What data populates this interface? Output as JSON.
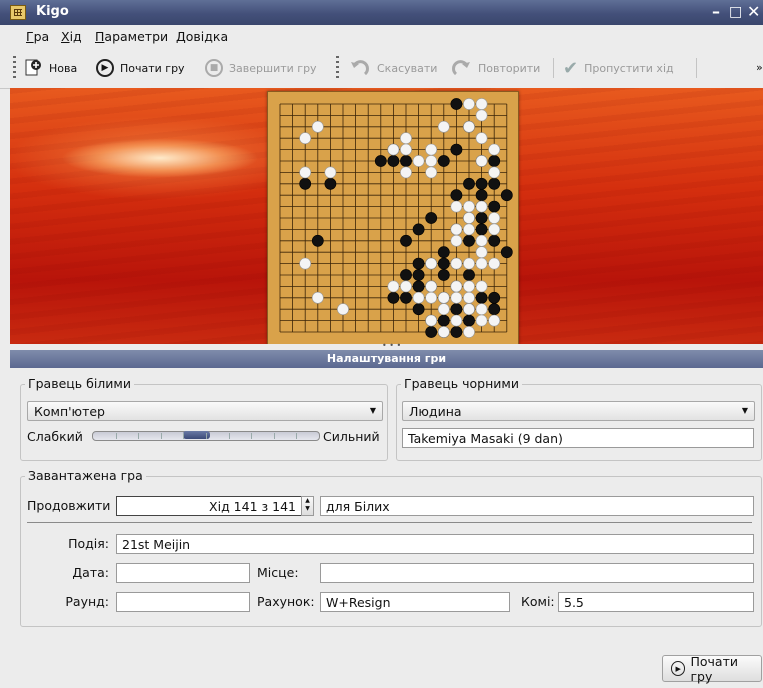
{
  "window": {
    "title": "Kigo"
  },
  "menu": [
    {
      "label": "Гра",
      "accel": "Г",
      "rest": "ра"
    },
    {
      "label": "Хід",
      "accel": "Х",
      "rest": "ід"
    },
    {
      "label": "Параметри",
      "accel": "П",
      "rest": "араметри"
    },
    {
      "label": "Довідка",
      "accel": "Д",
      "rest": "овідка"
    }
  ],
  "toolbar": {
    "new": "Нова",
    "start": "Почати гру",
    "finish": "Завершити гру",
    "undo": "Скасувати",
    "redo": "Повторити",
    "pass": "Пропустити хід"
  },
  "board": {
    "size": 19,
    "stones": {
      "black": [
        [
          14,
          0
        ],
        [
          15,
          2
        ],
        [
          9,
          4
        ],
        [
          14,
          4
        ],
        [
          8,
          5
        ],
        [
          9,
          5
        ],
        [
          10,
          5
        ],
        [
          13,
          5
        ],
        [
          16,
          5
        ],
        [
          17,
          5
        ],
        [
          2,
          7
        ],
        [
          4,
          7
        ],
        [
          15,
          7
        ],
        [
          16,
          7
        ],
        [
          17,
          7
        ],
        [
          14,
          8
        ],
        [
          16,
          8
        ],
        [
          18,
          8
        ],
        [
          16,
          9
        ],
        [
          17,
          9
        ],
        [
          12,
          10
        ],
        [
          15,
          10
        ],
        [
          16,
          10
        ],
        [
          11,
          11
        ],
        [
          14,
          11
        ],
        [
          16,
          11
        ],
        [
          3,
          12
        ],
        [
          10,
          12
        ],
        [
          15,
          12
        ],
        [
          17,
          12
        ],
        [
          13,
          13
        ],
        [
          18,
          13
        ],
        [
          11,
          14
        ],
        [
          12,
          14
        ],
        [
          13,
          14
        ],
        [
          14,
          14
        ],
        [
          10,
          15
        ],
        [
          11,
          15
        ],
        [
          13,
          15
        ],
        [
          15,
          15
        ],
        [
          11,
          16
        ],
        [
          12,
          16
        ],
        [
          14,
          16
        ],
        [
          9,
          17
        ],
        [
          10,
          17
        ],
        [
          13,
          17
        ],
        [
          16,
          17
        ],
        [
          17,
          17
        ],
        [
          11,
          18
        ],
        [
          14,
          18
        ],
        [
          15,
          18
        ],
        [
          17,
          18
        ],
        [
          12,
          19
        ],
        [
          13,
          19
        ],
        [
          15,
          19
        ],
        [
          12,
          20
        ],
        [
          13,
          20
        ],
        [
          14,
          20
        ]
      ],
      "white": [
        [
          15,
          0
        ],
        [
          16,
          0
        ],
        [
          16,
          1
        ],
        [
          3,
          2
        ],
        [
          13,
          2
        ],
        [
          15,
          2
        ],
        [
          2,
          3
        ],
        [
          10,
          3
        ],
        [
          16,
          3
        ],
        [
          9,
          4
        ],
        [
          10,
          4
        ],
        [
          12,
          4
        ],
        [
          17,
          4
        ],
        [
          11,
          5
        ],
        [
          12,
          5
        ],
        [
          16,
          5
        ],
        [
          2,
          6
        ],
        [
          4,
          6
        ],
        [
          10,
          6
        ],
        [
          12,
          6
        ],
        [
          17,
          6
        ],
        [
          14,
          9
        ],
        [
          15,
          9
        ],
        [
          16,
          9
        ],
        [
          15,
          10
        ],
        [
          17,
          10
        ],
        [
          14,
          11
        ],
        [
          15,
          11
        ],
        [
          17,
          11
        ],
        [
          14,
          12
        ],
        [
          16,
          12
        ],
        [
          16,
          13
        ],
        [
          2,
          14
        ],
        [
          12,
          14
        ],
        [
          14,
          14
        ],
        [
          15,
          14
        ],
        [
          16,
          14
        ],
        [
          17,
          14
        ],
        [
          9,
          16
        ],
        [
          10,
          16
        ],
        [
          12,
          16
        ],
        [
          14,
          16
        ],
        [
          15,
          16
        ],
        [
          16,
          16
        ],
        [
          3,
          17
        ],
        [
          11,
          17
        ],
        [
          12,
          17
        ],
        [
          13,
          17
        ],
        [
          14,
          17
        ],
        [
          15,
          17
        ],
        [
          5,
          18
        ],
        [
          13,
          18
        ],
        [
          15,
          18
        ],
        [
          16,
          18
        ],
        [
          12,
          19
        ],
        [
          14,
          19
        ],
        [
          16,
          19
        ],
        [
          17,
          19
        ],
        [
          13,
          20
        ],
        [
          15,
          20
        ]
      ]
    }
  },
  "panel": {
    "title": "Налаштування гри",
    "white_player": {
      "group": "Гравець білими",
      "type": "Комп'ютер",
      "weak": "Слабкий",
      "strong": "Сильний",
      "strength_level": 0.45
    },
    "black_player": {
      "group": "Гравець чорними",
      "type": "Людина",
      "name": "Takemiya Masaki (9 dan)"
    },
    "loaded_game": {
      "group": "Завантажена гра",
      "continue_label": "Продовжити",
      "move_value": "Хід 141 з 141",
      "for_whom": "для Білих",
      "event_label": "Подія:",
      "event": "21st Meijin",
      "date_label": "Дата:",
      "date": "",
      "place_label": "Місце:",
      "place": "",
      "round_label": "Раунд:",
      "round": "",
      "score_label": "Рахунок:",
      "score": "W+Resign",
      "komi_label": "Комі:",
      "komi": "5.5"
    },
    "start_button": "Почати гру"
  }
}
